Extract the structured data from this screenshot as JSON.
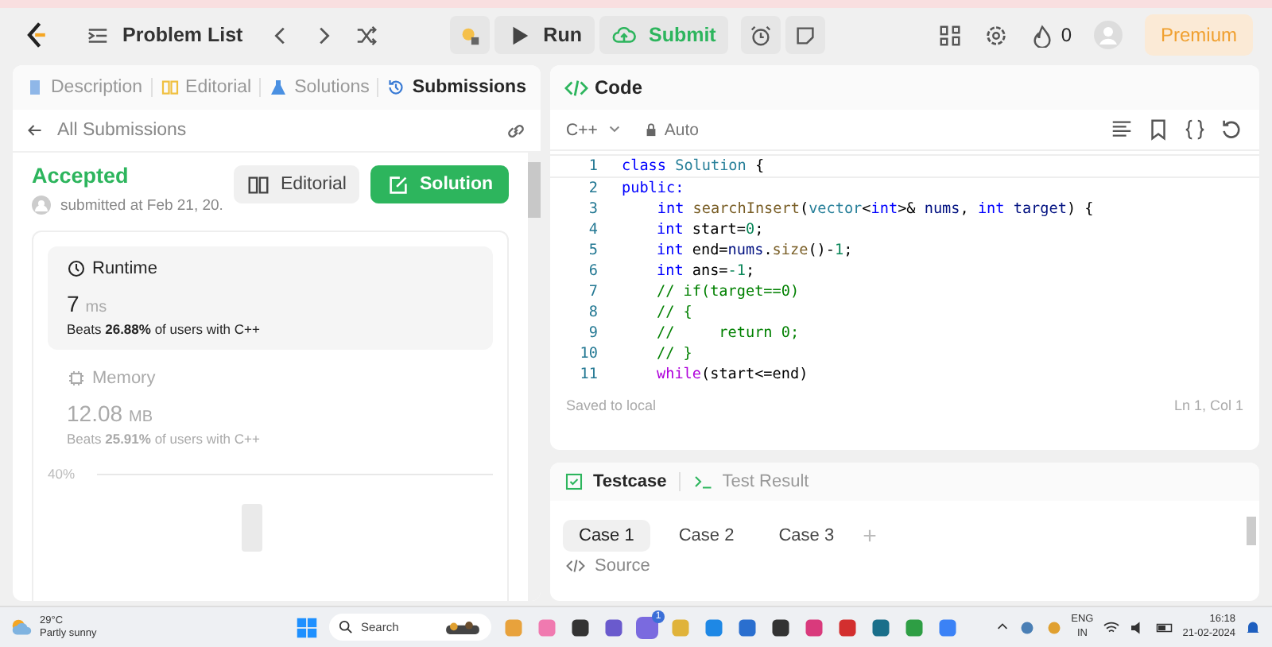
{
  "top_bar": {
    "nav_title": "Problem List",
    "run": "Run",
    "submit": "Submit",
    "streak": "0",
    "premium": "Premium"
  },
  "left_panel": {
    "tabs": [
      {
        "label": "Description",
        "selected": false,
        "kind": "doc"
      },
      {
        "label": "Editorial",
        "selected": false,
        "kind": "book"
      },
      {
        "label": "Solutions",
        "selected": false,
        "kind": "flask"
      },
      {
        "label": "Submissions",
        "selected": true,
        "kind": "history"
      }
    ],
    "back_label": "All Submissions",
    "status": "Accepted",
    "submitted": "submitted at Feb 21, 20.",
    "editorial_button": "Editorial",
    "solution_button": "Solution",
    "stats": [
      {
        "kind": "runtime",
        "title": "Runtime",
        "value": "7",
        "unit": "ms",
        "beats": "Beats **26.88%** of users with C++",
        "selected": true
      },
      {
        "kind": "memory",
        "title": "Memory",
        "value": "12.08",
        "unit": "MB",
        "beats": "Beats **25.91%** of users with C++",
        "selected": false
      }
    ],
    "chart_tick": "40%"
  },
  "editor": {
    "title": "Code",
    "language": "C++",
    "mode": "Auto",
    "lines": [
      {
        "number": "1",
        "indented": false,
        "tokens": [
          {
            "t": "class ",
            "kind": "kw"
          },
          {
            "t": "Solution",
            "kind": "type"
          },
          {
            "t": " {",
            "kind": "plain"
          }
        ]
      },
      {
        "number": "2",
        "indented": false,
        "tokens": [
          {
            "t": "public:",
            "kind": "kw"
          }
        ]
      },
      {
        "number": "3",
        "indented": false,
        "tokens": [
          {
            "t": "    int ",
            "kind": "kw"
          },
          {
            "t": "searchInsert",
            "kind": "fn"
          },
          {
            "t": "(",
            "kind": "plain"
          },
          {
            "t": "vector",
            "kind": "type"
          },
          {
            "t": "<",
            "kind": "plain"
          },
          {
            "t": "int",
            "kind": "kw"
          },
          {
            "t": ">& ",
            "kind": "plain"
          },
          {
            "t": "nums",
            "kind": "var"
          },
          {
            "t": ", ",
            "kind": "plain"
          },
          {
            "t": "int ",
            "kind": "kw"
          },
          {
            "t": "target",
            "kind": "var"
          },
          {
            "t": ") {",
            "kind": "plain"
          }
        ]
      },
      {
        "number": "4",
        "indented": true,
        "tokens": [
          {
            "t": "int",
            "kind": "kw"
          },
          {
            "t": " start=",
            "kind": "plain"
          },
          {
            "t": "0",
            "kind": "num"
          },
          {
            "t": ";",
            "kind": "plain"
          }
        ]
      },
      {
        "number": "5",
        "indented": true,
        "tokens": [
          {
            "t": "int",
            "kind": "kw"
          },
          {
            "t": " end=",
            "kind": "plain"
          },
          {
            "t": "nums",
            "kind": "var"
          },
          {
            "t": ".",
            "kind": "plain"
          },
          {
            "t": "size",
            "kind": "fn"
          },
          {
            "t": "()-",
            "kind": "plain"
          },
          {
            "t": "1",
            "kind": "num"
          },
          {
            "t": ";",
            "kind": "plain"
          }
        ]
      },
      {
        "number": "6",
        "indented": true,
        "tokens": [
          {
            "t": "int",
            "kind": "kw"
          },
          {
            "t": " ans=",
            "kind": "plain"
          },
          {
            "t": "-1",
            "kind": "num"
          },
          {
            "t": ";",
            "kind": "plain"
          }
        ]
      },
      {
        "number": "7",
        "indented": true,
        "tokens": [
          {
            "t": "// if(target==0)",
            "kind": "cm"
          }
        ]
      },
      {
        "number": "8",
        "indented": true,
        "tokens": [
          {
            "t": "// {",
            "kind": "cm"
          }
        ]
      },
      {
        "number": "9",
        "indented": true,
        "tokens": [
          {
            "t": "//     return 0;",
            "kind": "cm"
          }
        ]
      },
      {
        "number": "10",
        "indented": true,
        "tokens": [
          {
            "t": "// }",
            "kind": "cm"
          }
        ]
      },
      {
        "number": "11",
        "indented": true,
        "tokens": [
          {
            "t": "while",
            "kind": "ctrl"
          },
          {
            "t": "(start<=end)",
            "kind": "plain"
          }
        ]
      }
    ],
    "status": "Saved to local",
    "cursor": "Ln 1, Col 1"
  },
  "console": {
    "tabs": [
      {
        "label": "Testcase",
        "selected": true,
        "kind": "check"
      },
      {
        "label": "Test Result",
        "selected": false,
        "kind": "terminal"
      }
    ],
    "cases": [
      {
        "label": "Case 1",
        "selected": true
      },
      {
        "label": "Case 2",
        "selected": false
      },
      {
        "label": "Case 3",
        "selected": false
      }
    ],
    "add": "+",
    "source": "Source"
  },
  "taskbar": {
    "temperature": "29°C",
    "weather": "Partly sunny",
    "search": "Search",
    "chat_badge": "1",
    "language": "ENG",
    "region": "IN",
    "time": "16:18",
    "date": "21-02-2024"
  }
}
